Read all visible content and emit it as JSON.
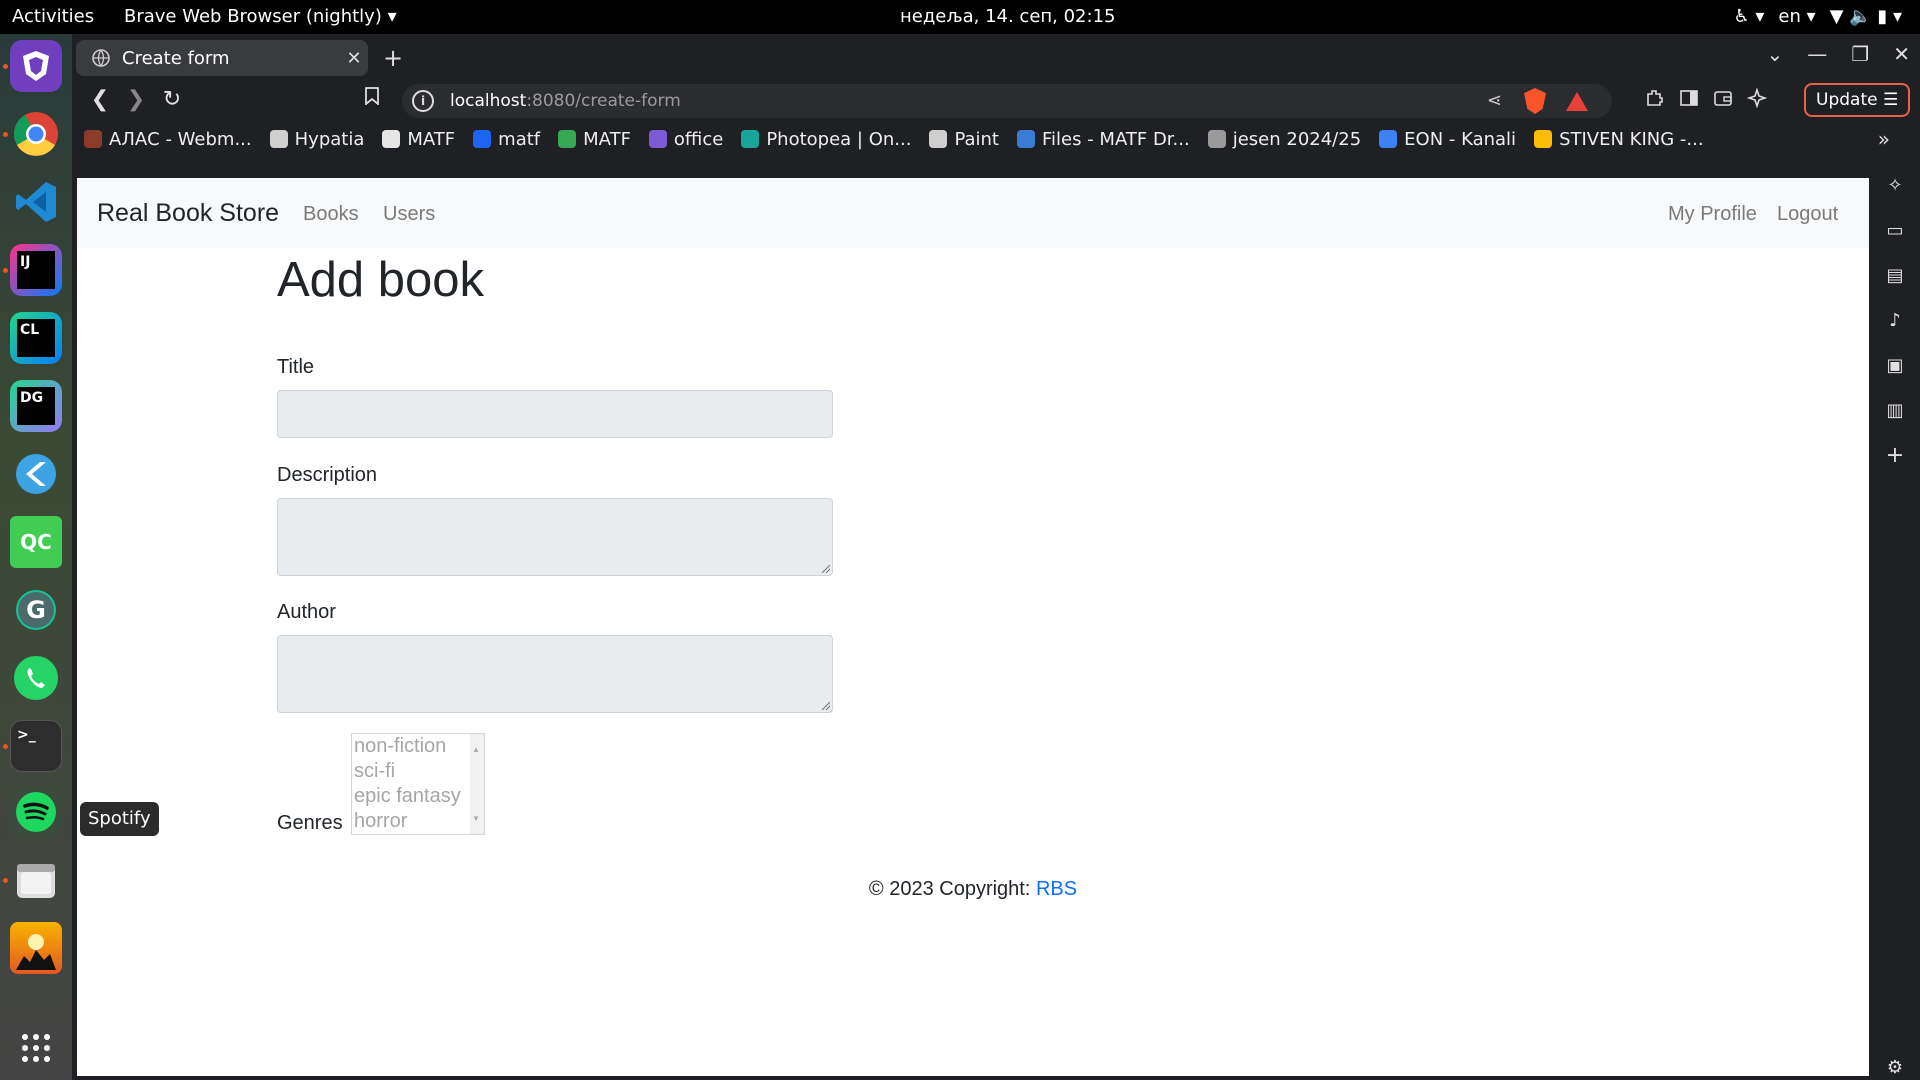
{
  "topbar": {
    "activities": "Activities",
    "app_menu": "Brave Web Browser (nightly) ▾",
    "clock": "недеља, 14. сеп, 02:15",
    "accessibility": "♿ ▾",
    "lang": "en ▾",
    "status_icons": "▼ 🔈 ▮ ▾"
  },
  "dock": {
    "tooltip": "Spotify",
    "items": [
      "brave-nightly",
      "chrome",
      "vscode",
      "intellij",
      "clion",
      "datagrip",
      "flutter",
      "qtcreator",
      "grammarly",
      "whatsapp",
      "terminal",
      "spotify",
      "files",
      "game",
      "app-grid"
    ],
    "labels": {
      "intellij": "IJ",
      "clion": "CL",
      "datagrip": "DG",
      "qtcreator": "QC",
      "terminal": ">_"
    }
  },
  "browser": {
    "tab_title": "Create form",
    "tab_close": "✕",
    "new_tab": "+",
    "window_controls": {
      "list": "⌄",
      "minimize": "—",
      "restore": "❐",
      "close": "✕"
    },
    "nav": {
      "back": "❮",
      "forward": "❯",
      "reload": "↻",
      "bookmark": "🔖"
    },
    "url_host": "localhost",
    "url_path": ":8080/create-form",
    "info": "i",
    "share": "⋖",
    "update_label": "Update ☰",
    "bookmarks": [
      {
        "label": "АЛАС - Webm...",
        "color": "#8a3b2a"
      },
      {
        "label": "Hypatia",
        "color": "#cfcfcf"
      },
      {
        "label": "MATF",
        "color": "#e6e6e6"
      },
      {
        "label": "matf",
        "color": "#1c64f2"
      },
      {
        "label": "MATF",
        "color": "#34a853"
      },
      {
        "label": "office",
        "color": "#7b5cd6"
      },
      {
        "label": "Photopea | On...",
        "color": "#18a497"
      },
      {
        "label": "Paint",
        "color": "#cfcfcf"
      },
      {
        "label": "Files - MATF Dr...",
        "color": "#3a7bd5"
      },
      {
        "label": "jesen 2024/25",
        "color": "#9a9a9a"
      },
      {
        "label": "EON - Kanali",
        "color": "#3b82f6"
      },
      {
        "label": "STIVEN KING -...",
        "color": "#fbbc04"
      }
    ],
    "bookmarks_more": "»"
  },
  "page": {
    "brand": "Real Book Store",
    "nav_books": "Books",
    "nav_users": "Users",
    "nav_profile": "My Profile",
    "nav_logout": "Logout",
    "title": "Add book",
    "label_title": "Title",
    "label_description": "Description",
    "label_author": "Author",
    "label_genres": "Genres",
    "genres": [
      "non-fiction",
      "sci-fi",
      "epic fantasy",
      "horror"
    ],
    "footer_text": "© 2023 Copyright: ",
    "footer_link": "RBS"
  }
}
